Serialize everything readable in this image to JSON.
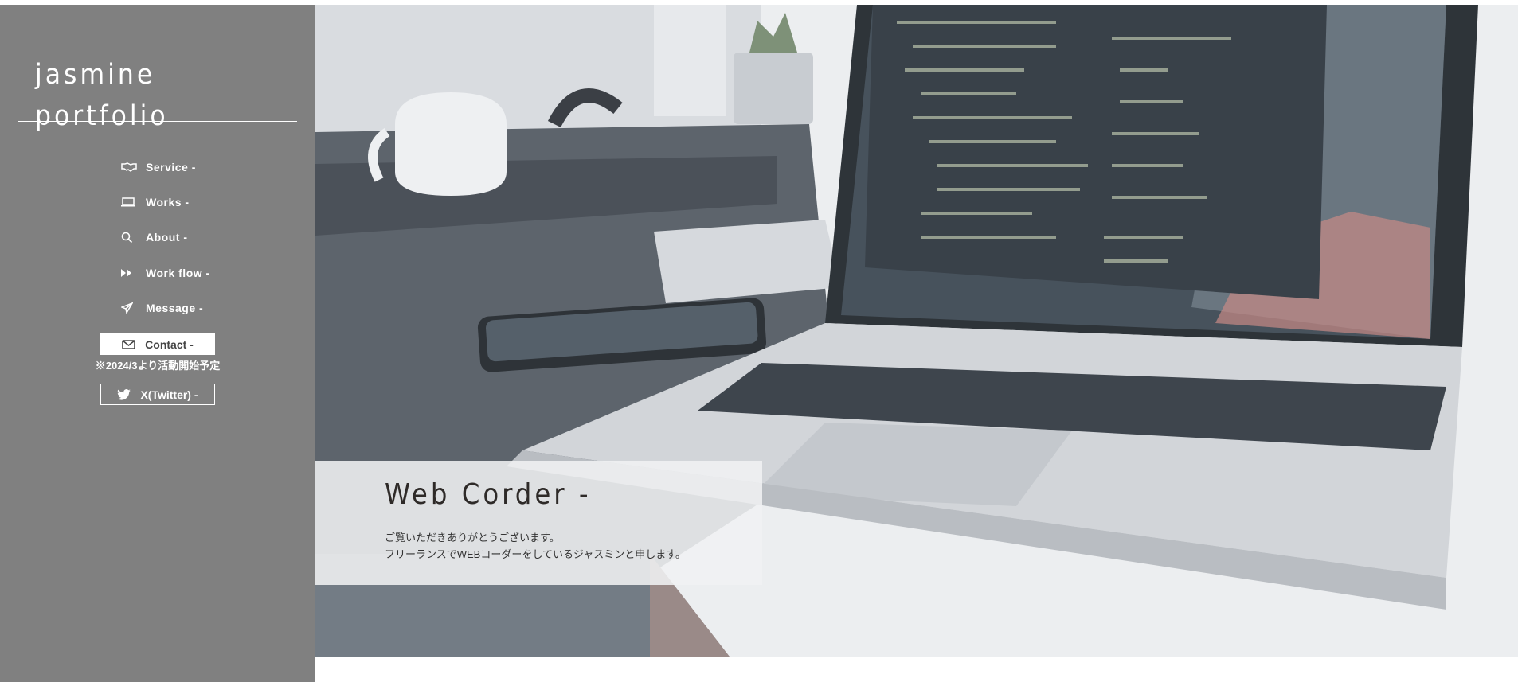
{
  "sidebar": {
    "logo_line1": "jasmine",
    "logo_line2": "portfolio",
    "nav": [
      {
        "label": "Service -",
        "icon": "handshake-icon"
      },
      {
        "label": "Works -",
        "icon": "laptop-icon"
      },
      {
        "label": "About -",
        "icon": "search-icon"
      },
      {
        "label": "Work flow -",
        "icon": "fast-forward-icon"
      },
      {
        "label": "Message -",
        "icon": "paper-plane-icon"
      }
    ],
    "contact": {
      "label": "Contact -",
      "icon": "envelope-icon"
    },
    "note": "※2024/3より活動開始予定",
    "twitter": {
      "label": "X(Twitter) -",
      "icon": "twitter-icon"
    }
  },
  "hero": {
    "title": "Web Corder -",
    "line1": "ご覧いただきありがとうございます。",
    "line2": "フリーランスでWEBコーダーをしているジャスミンと申します。"
  },
  "colors": {
    "sidebar": "#808080",
    "text": "#ffffff",
    "title": "#2e2a28"
  }
}
